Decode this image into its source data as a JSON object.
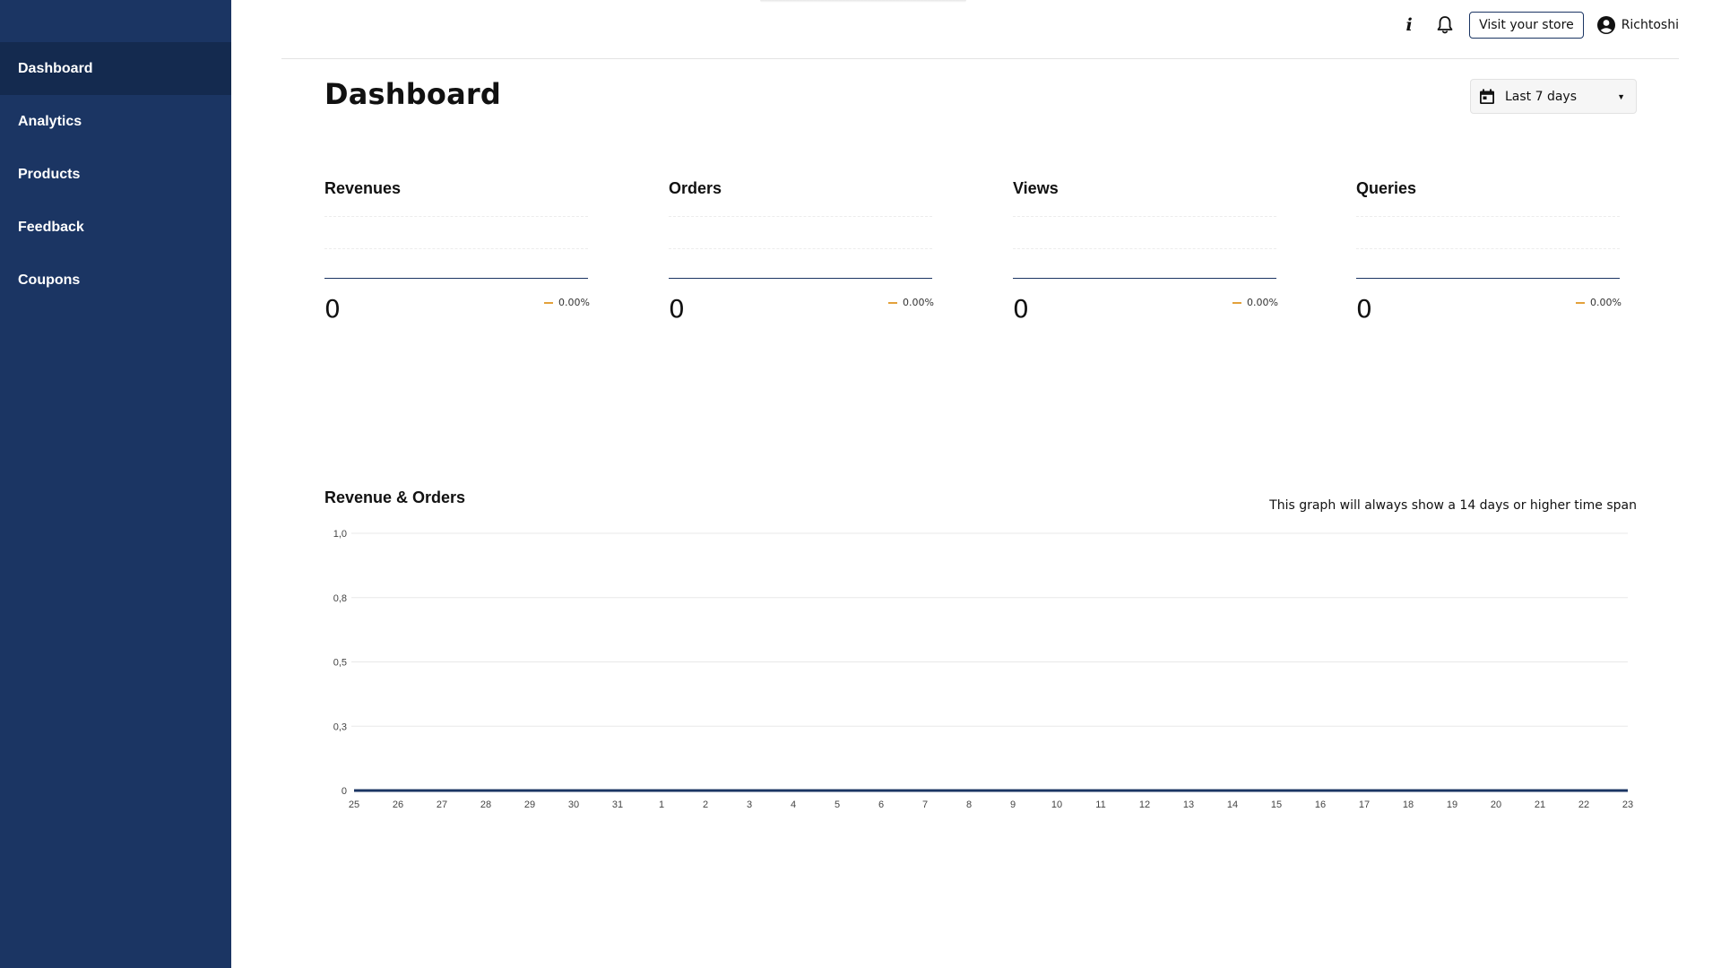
{
  "sidebar": {
    "items": [
      {
        "label": "Dashboard",
        "active": true
      },
      {
        "label": "Analytics",
        "active": false
      },
      {
        "label": "Products",
        "active": false
      },
      {
        "label": "Feedback",
        "active": false
      },
      {
        "label": "Coupons",
        "active": false
      }
    ]
  },
  "topbar": {
    "info_icon": "info-icon",
    "bell_icon": "bell-icon",
    "visit_store_label": "Visit your store",
    "user_icon": "account-circle-icon",
    "username": "Richtoshi"
  },
  "header": {
    "title": "Dashboard",
    "date_range": {
      "icon": "calendar-icon",
      "selected": "Last 7 days"
    }
  },
  "cards": [
    {
      "title": "Revenues",
      "value": "0",
      "change": "0.00%"
    },
    {
      "title": "Orders",
      "value": "0",
      "change": "0.00%"
    },
    {
      "title": "Views",
      "value": "0",
      "change": "0.00%"
    },
    {
      "title": "Queries",
      "value": "0",
      "change": "0.00%"
    }
  ],
  "colors": {
    "sidebar": "#1b3563",
    "sidebar_active": "#142a4f",
    "accent_change": "#e3a13b",
    "series": "#1b3563"
  },
  "chart_data": {
    "type": "line",
    "title": "Revenue & Orders",
    "note": "This graph will always show a 14 days or higher time span",
    "x": [
      "25",
      "26",
      "27",
      "28",
      "29",
      "30",
      "31",
      "1",
      "2",
      "3",
      "4",
      "5",
      "6",
      "7",
      "8",
      "9",
      "10",
      "11",
      "12",
      "13",
      "14",
      "15",
      "16",
      "17",
      "18",
      "19",
      "20",
      "21",
      "22",
      "23"
    ],
    "yticks": [
      "0",
      "0,3",
      "0,5",
      "0,8",
      "1,0"
    ],
    "ylim": [
      0,
      1
    ],
    "series": [
      {
        "values": [
          0,
          0,
          0,
          0,
          0,
          0,
          0,
          0,
          0,
          0,
          0,
          0,
          0,
          0,
          0,
          0,
          0,
          0,
          0,
          0,
          0,
          0,
          0,
          0,
          0,
          0,
          0,
          0,
          0,
          0
        ]
      }
    ],
    "grid": true
  }
}
